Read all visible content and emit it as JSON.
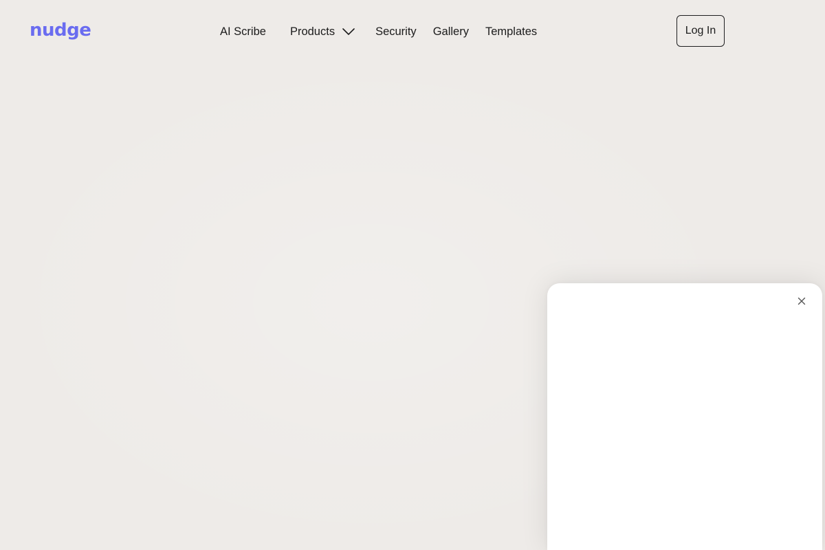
{
  "brand": {
    "logo_text": "nudge",
    "accent_color": "#6a6cf0"
  },
  "nav": {
    "ai_scribe": "AI Scribe",
    "products": "Products",
    "products_icon": "chevron-down-icon",
    "security": "Security",
    "gallery": "Gallery",
    "templates": "Templates"
  },
  "header": {
    "login_label": "Log In"
  },
  "popup": {
    "close_icon": "close-icon"
  }
}
